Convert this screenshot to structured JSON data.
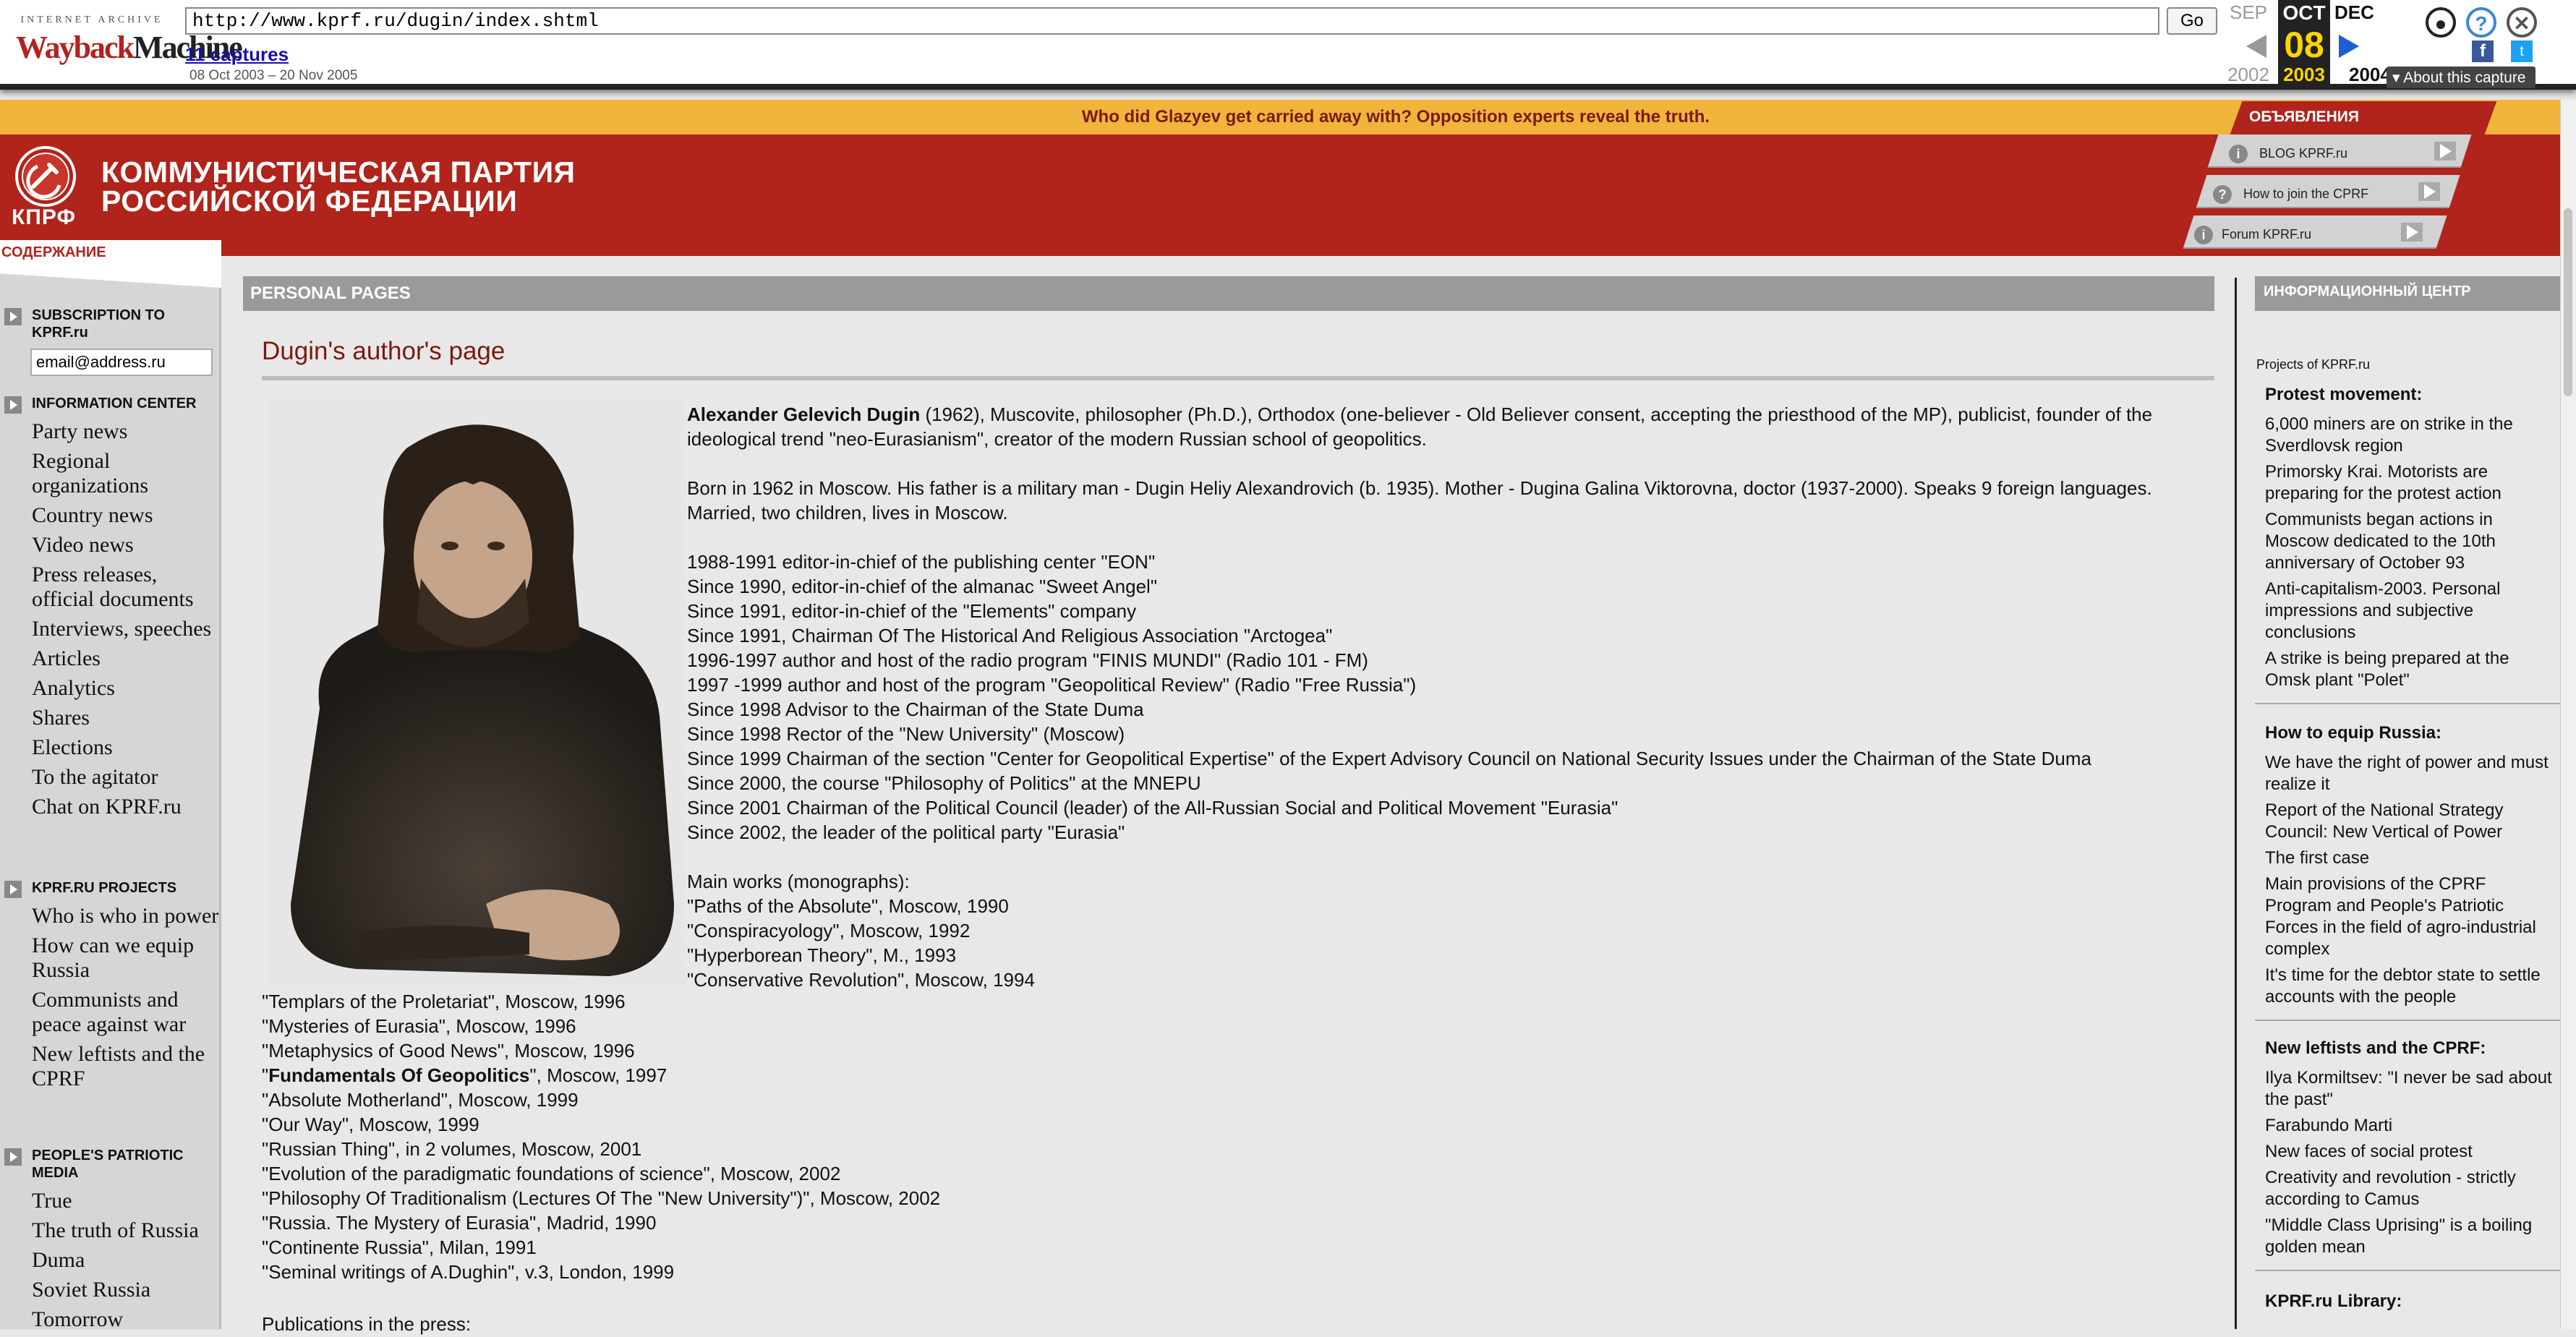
{
  "wayback": {
    "logo_top": "INTERNET ARCHIVE",
    "logo_wayback": "Wayback",
    "logo_machine": "Machine",
    "url": "http://www.kprf.ru/dugin/index.shtml",
    "go_label": "Go",
    "captures": "11 captures",
    "range": "08 Oct 2003 – 20 Nov 2005",
    "prev_month": "SEP",
    "cur_month": "OCT",
    "next_month": "DEC",
    "cur_day": "08",
    "prev_year": "2002",
    "cur_year": "2003",
    "next_year": "2004",
    "about": "▾ About this capture",
    "fb": "f",
    "tw": "t"
  },
  "site": {
    "news_line": "Who did Glazyev get carried away with? Opposition experts reveal the truth.",
    "party_name_1": "КОММУНИСТИЧЕСКАЯ ПАРТИЯ",
    "party_name_2": "РОССИЙСКОЙ ФЕДЕРАЦИИ",
    "emblem_text": "КПРФ",
    "ads_label": "ОБЪЯВЛЕНИЯ",
    "ads": [
      "BLOG KPRF.ru",
      "How to join the CPRF",
      "Forum KPRF.ru"
    ],
    "colors": {
      "brand_red": "#b0241b",
      "news_yellow": "#f0b53a",
      "title_red": "#7a1a10"
    }
  },
  "left": {
    "contents": "СОДЕРЖАНИЕ",
    "subscription_title": "SUBSCRIPTION TO KPRF.ru",
    "email_value": "email@address.ru",
    "info_center_title": "INFORMATION CENTER",
    "info_center_links": [
      "Party news",
      "Regional organizations",
      "Country news",
      "Video news",
      "Press releases, official documents",
      "Interviews, speeches",
      "Articles",
      "Analytics",
      "Shares",
      "Elections",
      "To the agitator",
      "Chat on KPRF.ru"
    ],
    "projects_title": "KPRF.RU PROJECTS",
    "projects_links": [
      "Who is who in power",
      "How can we equip Russia",
      "Communists and peace against war",
      "New leftists and the CPRF"
    ],
    "media_title": "PEOPLE'S PATRIOTIC MEDIA",
    "media_links": [
      "True",
      "The truth of Russia",
      "Duma",
      "Soviet Russia",
      "Tomorrow"
    ]
  },
  "main": {
    "section_bar": "PERSONAL PAGES",
    "title": "Dugin's author's page",
    "bio_name": "Alexander Gelevich Dugin",
    "bio_intro": " (1962), Muscovite, philosopher (Ph.D.), Orthodox (one-believer - Old Believer consent, accepting the priesthood of the MP), publicist, founder of the ideological trend \"neo-Eurasianism\", creator of the modern Russian school of geopolitics.",
    "bio_born": "Born in 1962 in Moscow. His father is a military man - Dugin Heliy Alexandrovich (b. 1935). Mother - Dugina Galina Viktorovna, doctor (1937-2000). Speaks 9 foreign languages. Married, two children, lives in Moscow.",
    "career": [
      "1988-1991 editor-in-chief of the publishing center \"EON\"",
      "Since 1990, editor-in-chief of the almanac \"Sweet Angel\"",
      "Since 1991, editor-in-chief of the \"Elements\" company",
      "Since 1991, Chairman Of The Historical And Religious Association \"Arctogea\"",
      "1996-1997 author and host of the radio program \"FINIS MUNDI\" (Radio 101 - FM)",
      "1997 -1999 author and host of the program \"Geopolitical Review\" (Radio \"Free Russia\")",
      "Since 1998 Advisor to the Chairman of the State Duma",
      "Since 1998 Rector of the \"New University\" (Moscow)",
      "Since 1999 Chairman of the section \"Center for Geopolitical Expertise\" of the Expert Advisory Council on National Security Issues under the Chairman of the State Duma",
      "Since 2000, the course \"Philosophy of Politics\" at the MNEPU",
      "Since 2001 Chairman of the Political Council (leader) of the All-Russian Social and Political Movement \"Eurasia\"",
      "Since 2002, the leader of the political party \"Eurasia\""
    ],
    "works_title": "Main works (monographs):",
    "works_a": [
      "\"Paths of the Absolute\", Moscow, 1990",
      "\"Conspiracyology\", Moscow, 1992",
      "\"Hyperborean Theory\", M., 1993",
      "\"Conservative Revolution\", Moscow, 1994"
    ],
    "works_b1": [
      "\"Templars of the Proletariat\", Moscow, 1996",
      "\"Mysteries of Eurasia\", Moscow, 1996",
      "\"Metaphysics of Good News\", Moscow, 1996"
    ],
    "fundamentals_bold": "Fundamentals Of Geopolitics",
    "fundamentals_rest": "\", Moscow, 1997",
    "works_b2": [
      "\"Absolute Motherland\", Moscow, 1999",
      "\"Our Way\", Moscow, 1999",
      "\"Russian Thing\", in 2 volumes, Moscow, 2001",
      "\"Evolution of the paradigmatic foundations of science\", Moscow, 2002",
      "\"Philosophy Of Traditionalism (Lectures Of The \"New University\")\", Moscow, 2002",
      "\"Russia. The Mystery of Eurasia\", Madrid, 1990",
      "\"Continente Russia\", Milan, 1991",
      "\"Seminal writings of A.Dughin\", v.3, London, 1999"
    ],
    "publications": "Publications in the press:"
  },
  "right": {
    "header": "ИНФОРМАЦИОННЫЙ ЦЕНТР",
    "projects_label": "Projects of KPRF.ru",
    "sections": [
      {
        "title": "Protest movement:",
        "items": [
          "6,000 miners are on strike in the Sverdlovsk region",
          "Primorsky Krai. Motorists are preparing for the protest action",
          "Communists began actions in Moscow dedicated to the 10th anniversary of October 93",
          "Anti-capitalism-2003. Personal impressions and subjective conclusions",
          "A strike is being prepared at the Omsk plant \"Polet\""
        ]
      },
      {
        "title": "How to equip Russia:",
        "items": [
          "We have the right of power and must realize it",
          "Report of the National Strategy Council: New Vertical of Power",
          "The first case",
          "Main provisions of the CPRF Program and People's Patriotic Forces in the field of agro-industrial complex",
          "It's time for the debtor state to settle accounts with the people"
        ]
      },
      {
        "title": "New leftists and the CPRF:",
        "items": [
          "Ilya Kormiltsev: \"I never be sad about the past\"",
          "Farabundo Marti",
          "New faces of social protest",
          "Creativity and revolution - strictly according to Camus",
          "\"Middle Class Uprising\" is a boiling golden mean"
        ]
      },
      {
        "title": "KPRF.ru Library:",
        "items": []
      }
    ]
  }
}
